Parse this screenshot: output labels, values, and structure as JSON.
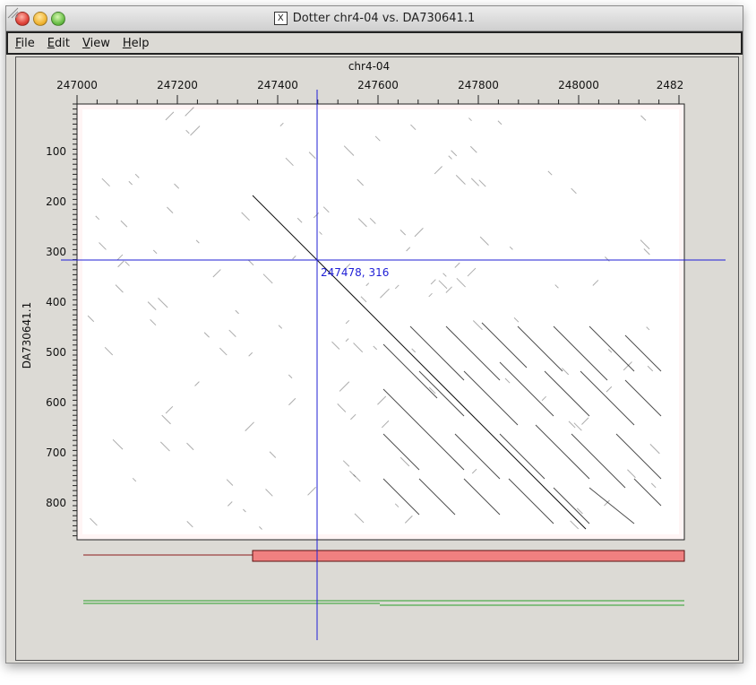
{
  "window": {
    "title": "Dotter chr4-04 vs. DA730641.1",
    "x_icon": "X"
  },
  "menu": [
    {
      "key": "F",
      "rest": "ile"
    },
    {
      "key": "E",
      "rest": "dit"
    },
    {
      "key": "V",
      "rest": "iew"
    },
    {
      "key": "H",
      "rest": "elp"
    }
  ],
  "plot": {
    "x_axis_label": "chr4-04",
    "y_axis_label": "DA730641.1",
    "x_ticks": [
      "247000",
      "247200",
      "247400",
      "247600",
      "247800",
      "248000",
      "2482"
    ],
    "y_ticks": [
      "100",
      "200",
      "300",
      "400",
      "500",
      "600",
      "700",
      "800"
    ],
    "crosshair_readout": "247478, 316",
    "crosshair_color": "#1f1fd6",
    "dot_color": "#111111"
  },
  "tracks": {
    "red_bar_color": "#f08080",
    "red_line_color": "#8b1a1a",
    "green_line_color": "#2ca02c"
  }
}
